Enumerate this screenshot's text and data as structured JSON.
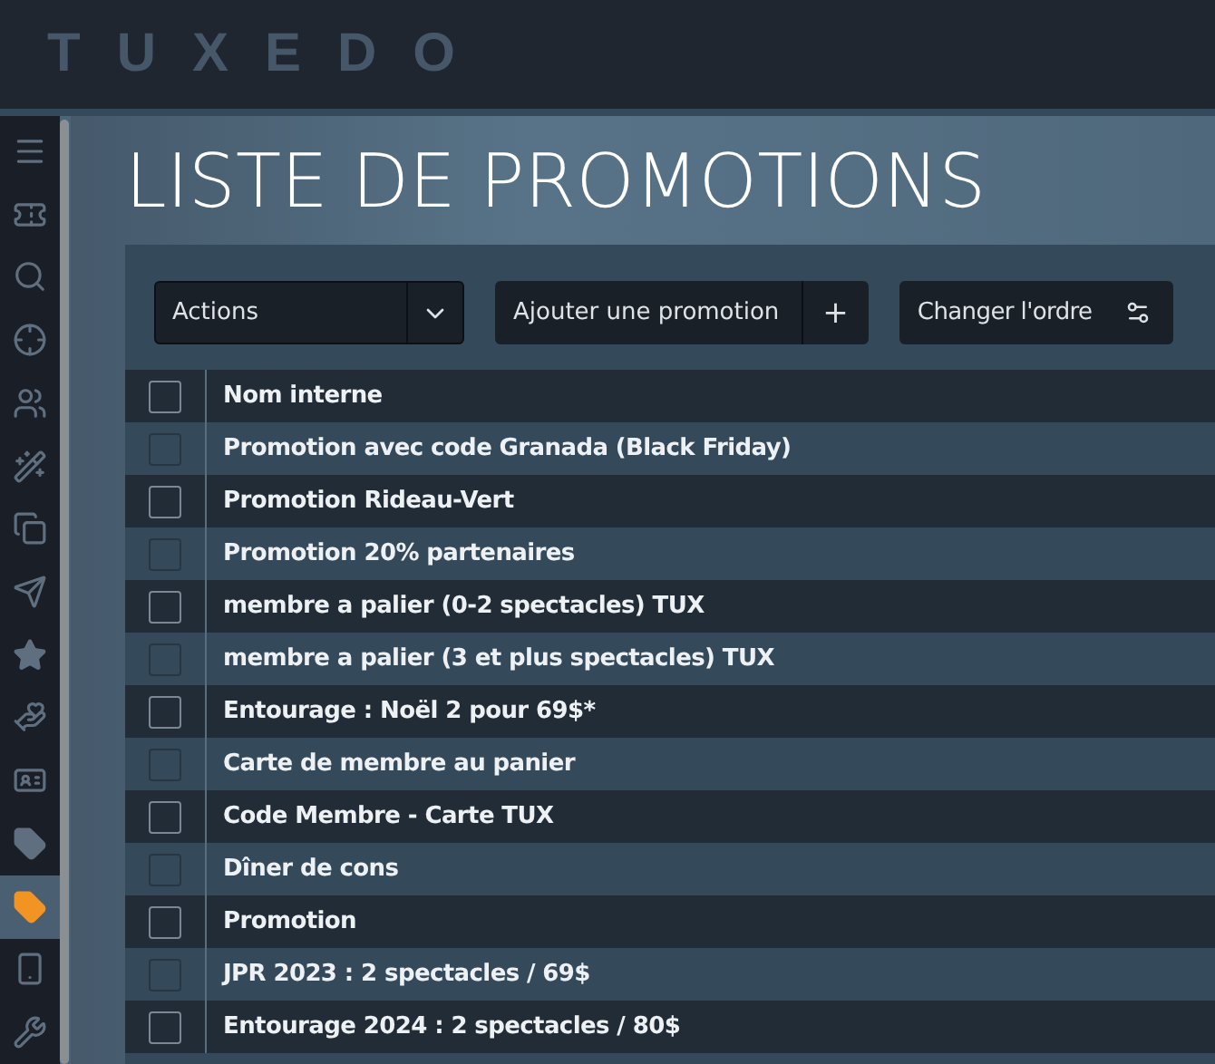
{
  "logo": "TUXEDO",
  "sidebar": {
    "items": [
      {
        "selected": false
      },
      {
        "selected": false
      },
      {
        "selected": false
      },
      {
        "selected": false
      },
      {
        "selected": false
      },
      {
        "selected": false
      },
      {
        "selected": false
      },
      {
        "selected": false
      },
      {
        "selected": false
      },
      {
        "selected": false
      },
      {
        "selected": false
      },
      {
        "selected": false
      },
      {
        "selected": true
      },
      {
        "selected": false
      },
      {
        "selected": false
      }
    ]
  },
  "title": "LISTE DE PROMOTIONS",
  "toolbar": {
    "actions_select": "Actions",
    "add_button": "Ajouter une promotion",
    "add_icon": "+",
    "reorder_button": "Changer l'ordre"
  },
  "table": {
    "columns": [
      "Nom interne"
    ],
    "header_checked": false,
    "rows": [
      {
        "name": "Promotion avec code Granada (Black Friday)",
        "checked": false
      },
      {
        "name": "Promotion Rideau-Vert",
        "checked": false
      },
      {
        "name": "Promotion 20% partenaires",
        "checked": false
      },
      {
        "name": "membre a palier (0-2 spectacles) TUX",
        "checked": false
      },
      {
        "name": "membre a palier (3 et plus spectacles) TUX",
        "checked": false
      },
      {
        "name": "Entourage : Noël 2 pour 69$*",
        "checked": false
      },
      {
        "name": "Carte de membre au panier",
        "checked": false
      },
      {
        "name": "Code Membre - Carte TUX",
        "checked": false
      },
      {
        "name": "Dîner de cons",
        "checked": false
      },
      {
        "name": "Promotion",
        "checked": false
      },
      {
        "name": "JPR 2023 : 2 spectacles / 69$",
        "checked": false
      },
      {
        "name": "Entourage 2024 : 2 spectacles / 80$",
        "checked": false
      }
    ]
  }
}
